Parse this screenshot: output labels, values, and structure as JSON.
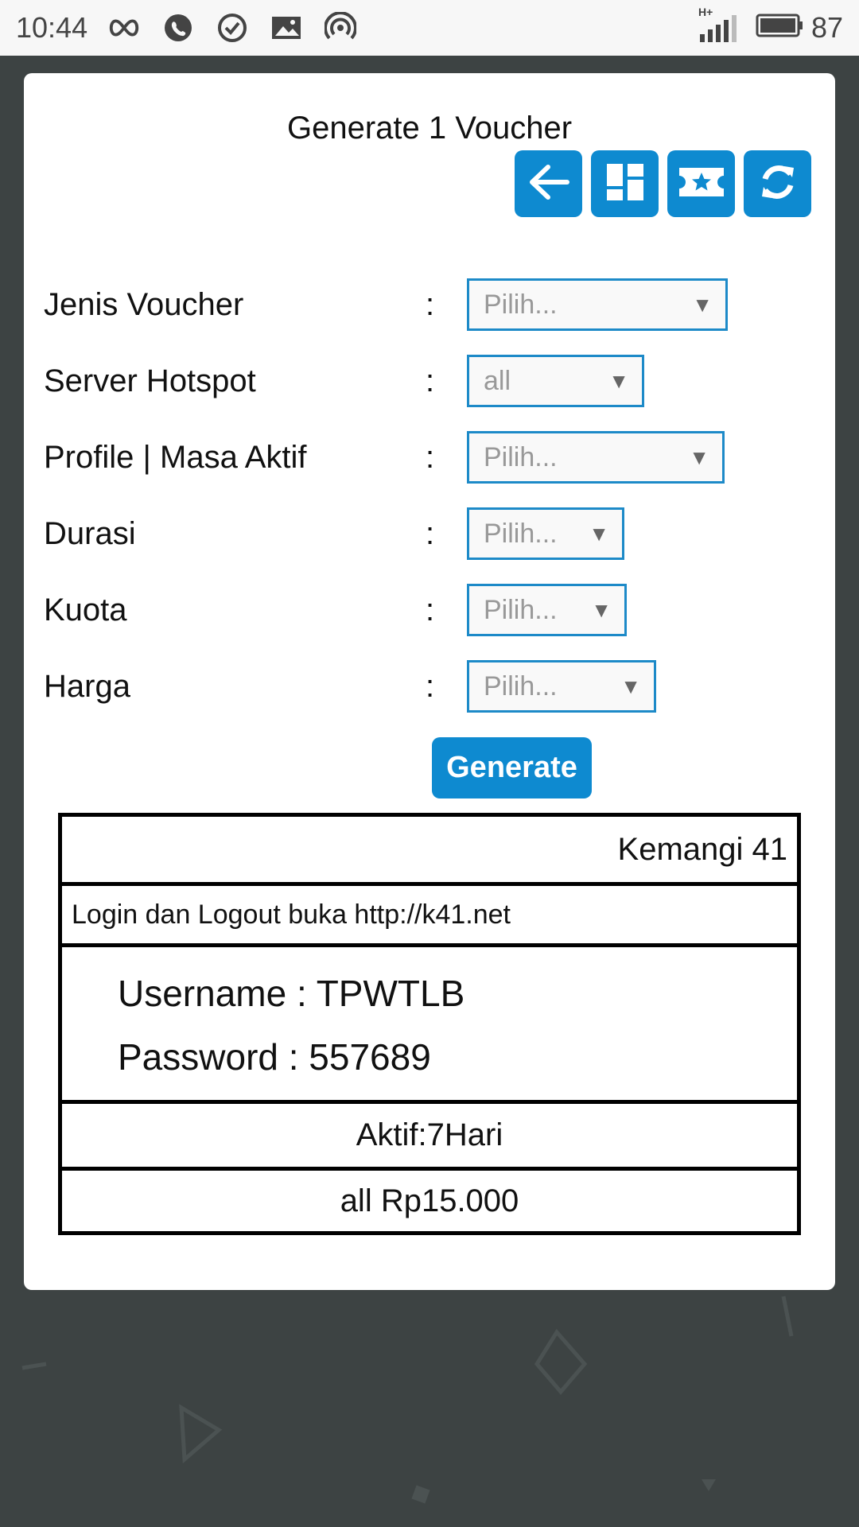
{
  "status_bar": {
    "time": "10:44",
    "left_icons": [
      "infinity-icon",
      "whatsapp-icon",
      "check-circle-icon",
      "image-icon",
      "hotspot-icon"
    ],
    "network": "H+",
    "battery": "87"
  },
  "page": {
    "title": "Generate 1 Voucher"
  },
  "toolbar": {
    "buttons": [
      "back-arrow-icon",
      "dashboard-icon",
      "ticket-icon",
      "refresh-icon"
    ]
  },
  "form": {
    "separator": ":",
    "fields": [
      {
        "label": "Jenis Voucher",
        "value": "Pilih..."
      },
      {
        "label": "Server Hotspot",
        "value": "all"
      },
      {
        "label": "Profile | Masa Aktif",
        "value": "Pilih..."
      },
      {
        "label": "Durasi",
        "value": "Pilih..."
      },
      {
        "label": "Kuota",
        "value": "Pilih..."
      },
      {
        "label": "Harga",
        "value": "Pilih..."
      }
    ],
    "caret": "▼",
    "generate_label": "Generate"
  },
  "voucher": {
    "header": "Kemangi 41",
    "login_note": "Login dan Logout buka http://k41.net",
    "username_line": "Username : TPWTLB",
    "password_line": "Password : 557689",
    "aktif": "Aktif:7Hari",
    "price": "all Rp15.000"
  },
  "colors": {
    "accent": "#0e8ad0",
    "background": "#3d4343",
    "select_border": "#1d8ac8"
  }
}
